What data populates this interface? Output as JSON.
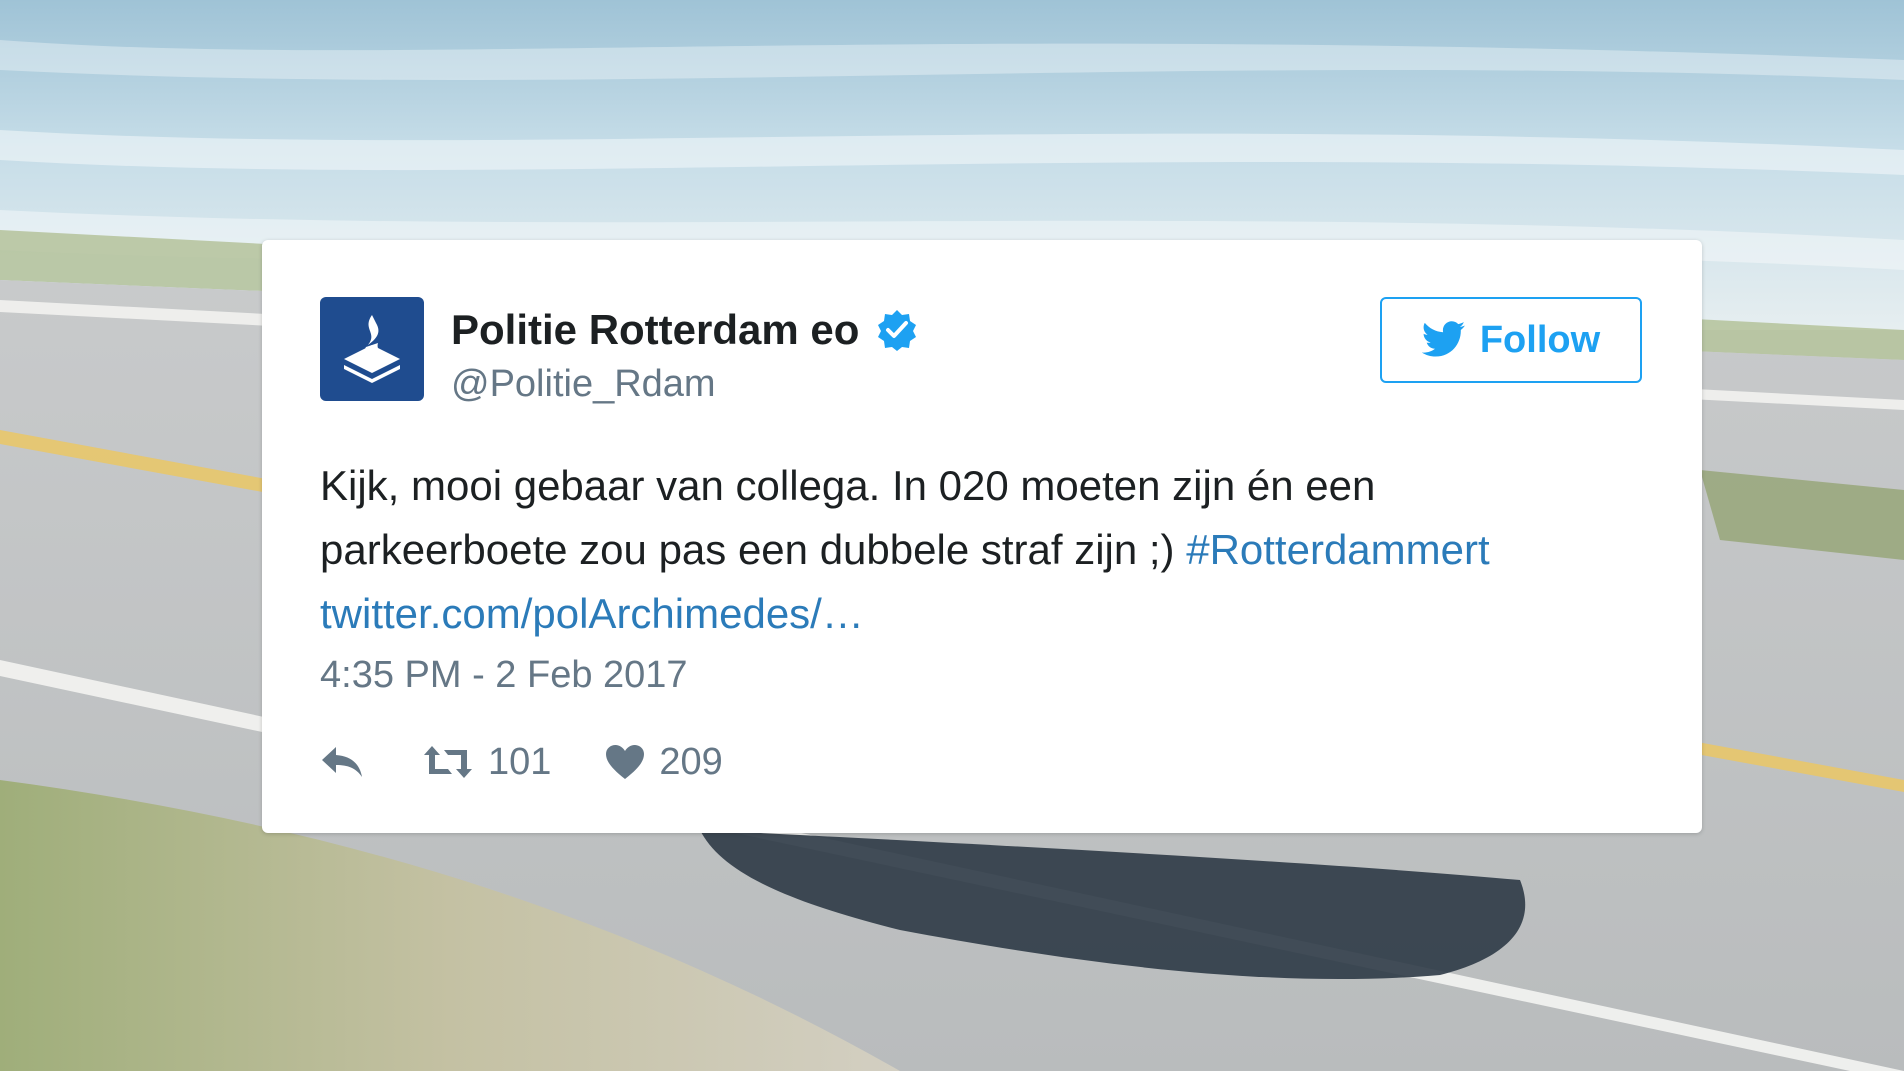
{
  "tweet": {
    "display_name": "Politie Rotterdam eo",
    "handle": "@Politie_Rdam",
    "verified": true,
    "follow_label": "Follow",
    "text_line1": "Kijk, mooi gebaar van collega. In 020 moeten zijn én een",
    "text_line2": "parkeerboete zou pas een dubbele straf zijn ;)",
    "hashtag": "#Rotterdammert",
    "link": "twitter.com/polArchimedes/…",
    "timestamp": "4:35 PM - 2 Feb 2017",
    "retweet_count": "101",
    "like_count": "209"
  },
  "colors": {
    "brand_blue": "#1da1f2",
    "link_blue": "#2b7bb9",
    "avatar_blue": "#1f4c8f",
    "text_dark": "#1c2022",
    "text_gray": "#657786"
  },
  "icons": {
    "avatar": "police-logo-icon",
    "verified": "verified-badge-icon",
    "follow": "twitter-bird-icon",
    "reply": "reply-icon",
    "retweet": "retweet-icon",
    "like": "heart-icon"
  }
}
